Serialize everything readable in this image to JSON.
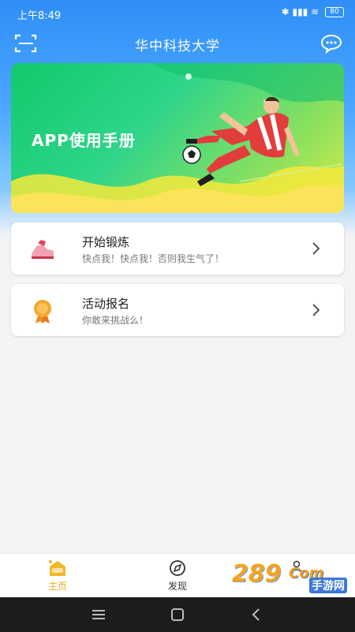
{
  "status_bar": {
    "time": "上午8:49",
    "battery": "80"
  },
  "header": {
    "title": "华中科技大学"
  },
  "banner": {
    "title": "APP使用手册"
  },
  "cards": [
    {
      "title": "开始锻炼",
      "subtitle": "快点我！快点我！否则我生气了！",
      "icon": "sneaker-icon"
    },
    {
      "title": "活动报名",
      "subtitle": "你敢来挑战么！",
      "icon": "medal-icon"
    }
  ],
  "tabs": [
    {
      "label": "主页",
      "icon": "home-icon",
      "active": true
    },
    {
      "label": "发现",
      "icon": "compass-icon",
      "active": false
    }
  ],
  "watermark": {
    "brand": "289",
    "suffix": "Com",
    "tagline": "手游网"
  },
  "colors": {
    "header_blue": "#2f8ff7",
    "banner_green": "#12c96c",
    "accent_orange": "#f0a91a"
  }
}
